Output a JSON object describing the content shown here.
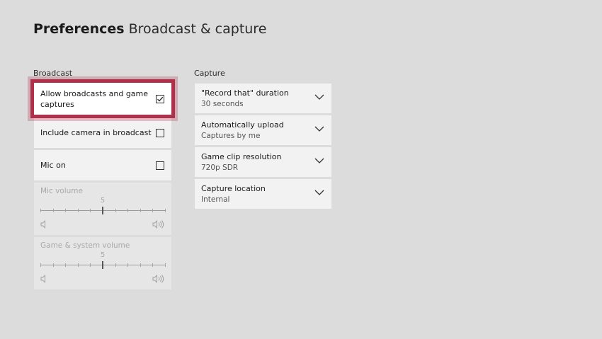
{
  "header": {
    "title": "Preferences",
    "subtitle": "Broadcast & capture"
  },
  "broadcast": {
    "label": "Broadcast",
    "toggles": [
      {
        "label": "Allow broadcasts and game captures",
        "checked": true,
        "selected": true
      },
      {
        "label": "Include camera in broadcast",
        "checked": false
      },
      {
        "label": "Mic on",
        "checked": false
      }
    ],
    "sliders": [
      {
        "label": "Mic volume",
        "value": "5",
        "level": 0.5
      },
      {
        "label": "Game & system volume",
        "value": "5",
        "level": 0.5
      }
    ]
  },
  "capture": {
    "label": "Capture",
    "items": [
      {
        "title": "\"Record that\" duration",
        "value": "30 seconds"
      },
      {
        "title": "Automatically upload",
        "value": "Captures by me"
      },
      {
        "title": "Game clip resolution",
        "value": "720p SDR"
      },
      {
        "title": "Capture location",
        "value": "Internal"
      }
    ]
  },
  "colors": {
    "background": "#dcdcdc",
    "tile": "#f2f2f2",
    "focus": "#b0304a"
  }
}
